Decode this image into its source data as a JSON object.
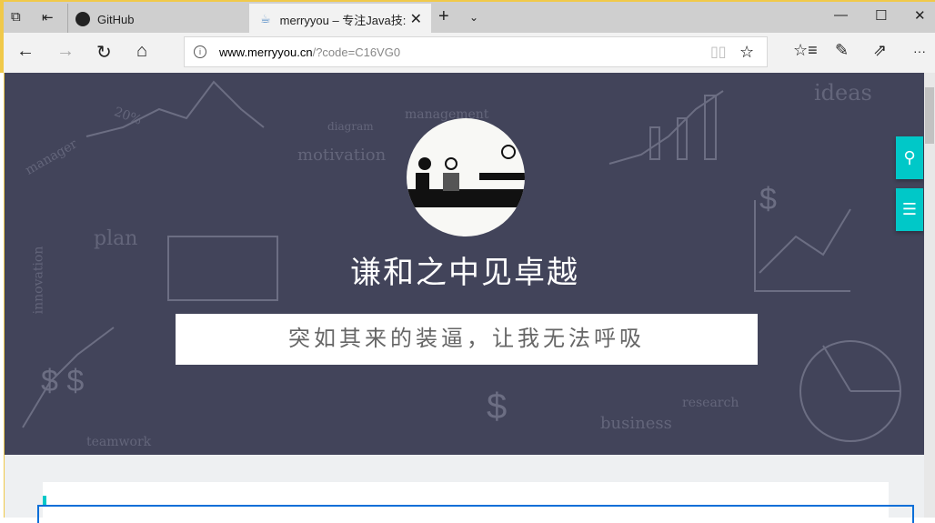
{
  "browser": {
    "tabs": [
      {
        "label": "GitHub",
        "icon": "github-icon"
      },
      {
        "label": "merryyou – 专注Java技:",
        "icon": "java-icon",
        "active": true
      }
    ],
    "url_host": "www.merryyou.cn",
    "url_path": "/?code=C16VG0"
  },
  "hero": {
    "title": "谦和之中见卓越",
    "subtitle": "突如其来的装逼，让我无法呼吸",
    "doodles": [
      "ideas",
      "plan",
      "motivation",
      "management",
      "diagram",
      "manager",
      "innovation",
      "research",
      "business",
      "teamwork",
      "20%"
    ]
  },
  "colors": {
    "hero_bg": "#42445a",
    "accent": "#00c8c8"
  }
}
